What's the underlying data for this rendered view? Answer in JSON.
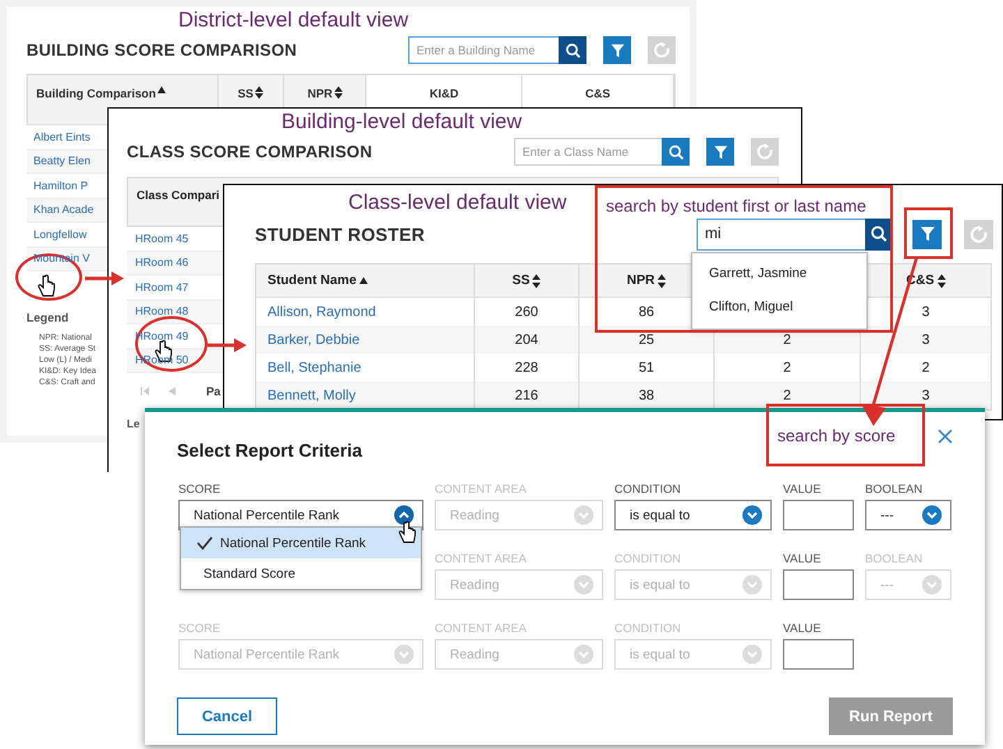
{
  "district": {
    "caption": "District-level default view",
    "title": "BUILDING SCORE COMPARISON",
    "search": {
      "placeholder": "Enter a Building Name"
    },
    "columns": [
      {
        "label": "Building Comparison",
        "sorted": true
      },
      {
        "label": "SS",
        "sorted": false
      },
      {
        "label": "NPR",
        "sorted": false
      },
      {
        "label": "KI&D"
      },
      {
        "label": "C&S"
      }
    ],
    "rows": [
      "Albert Eints",
      "Beatty Elen",
      "Hamilton P",
      "Khan Acade",
      "Longfellow",
      "Mountain V"
    ],
    "legend": {
      "title": "Legend",
      "items": [
        "NPR: National",
        "SS: Average St",
        "Low (L) / Medi",
        "KI&D: Key Idea",
        "C&S: Craft and"
      ]
    }
  },
  "building": {
    "caption": "Building-level default view",
    "title": "CLASS SCORE COMPARISON",
    "search": {
      "placeholder": "Enter a Class Name"
    },
    "columns": [
      {
        "label": "Class Compari"
      }
    ],
    "rows": [
      "HRoom 45",
      "HRoom 46",
      "HRoom 47",
      "HRoom 48",
      "HRoom 49",
      "HRoom 50"
    ],
    "pagination": {
      "label": "Pa"
    },
    "legend": {
      "title": "Le"
    }
  },
  "classroom": {
    "caption": "Class-level default view",
    "title": "STUDENT ROSTER",
    "search": {
      "value": "mi",
      "suggestions": [
        "Garrett, Jasmine",
        "Clifton, Miguel"
      ]
    },
    "columns": {
      "name": {
        "label": "Student Name",
        "sorted": true
      },
      "ss": {
        "label": "SS",
        "sorted": false
      },
      "npr": {
        "label": "NPR",
        "sorted": false
      },
      "cs": {
        "label": "C&S",
        "sorted": false
      }
    },
    "rows": [
      {
        "name": "Allison, Raymond",
        "ss": "260",
        "npr": "86",
        "cs": "3"
      },
      {
        "name": "Barker, Debbie",
        "ss": "204",
        "npr": "25",
        "column_4": "2",
        "cs": "3"
      },
      {
        "name": "Bell, Stephanie",
        "ss": "228",
        "npr": "51",
        "column_4": "2",
        "cs": "2"
      },
      {
        "name": "Bennett, Molly",
        "ss": "216",
        "npr": "38",
        "column_4": "2",
        "cs": "3"
      }
    ]
  },
  "annotations": [
    {
      "text": "search by student first or last name"
    },
    {
      "text": "search by score"
    }
  ],
  "modal": {
    "title": "Select Report Criteria",
    "criteria": [
      {
        "score": {
          "label": "SCORE",
          "value": "National Percentile Rank",
          "disabled": false,
          "open": true
        },
        "content_area": {
          "label": "CONTENT AREA",
          "value": "Reading",
          "disabled": true,
          "open": false
        },
        "condition": {
          "label": "CONDITION",
          "value": "is equal to",
          "disabled": false,
          "open": false
        },
        "value": {
          "label": "VALUE",
          "disabled": false
        },
        "boolean": {
          "label": "BOOLEAN",
          "value": "---",
          "disabled": false,
          "open": false
        }
      },
      {
        "content_area": {
          "label": "CONTENT AREA",
          "value": "Reading",
          "disabled": true,
          "open": false
        },
        "condition": {
          "label": "CONDITION",
          "value": "is equal to",
          "disabled": true,
          "open": false
        },
        "value": {
          "label": "VALUE",
          "disabled": false
        },
        "boolean": {
          "label": "BOOLEAN",
          "value": "---",
          "disabled": true,
          "open": false
        }
      },
      {
        "score": {
          "label": "SCORE",
          "value": "National Percentile Rank",
          "disabled": true,
          "open": false
        },
        "content_area": {
          "label": "CONTENT AREA",
          "value": "Reading",
          "disabled": true,
          "open": false
        },
        "condition": {
          "label": "CONDITION",
          "value": "is equal to",
          "disabled": true,
          "open": false
        },
        "value": {
          "label": "VALUE",
          "disabled": false
        }
      }
    ],
    "score_options": [
      {
        "label": "National Percentile Rank",
        "selected": true
      },
      {
        "label": "Standard Score",
        "selected": false
      }
    ],
    "buttons": [
      {
        "label": "Cancel",
        "kind": "outline",
        "disabled": false
      },
      {
        "label": "Run Report",
        "kind": "primary",
        "disabled": true
      }
    ]
  }
}
